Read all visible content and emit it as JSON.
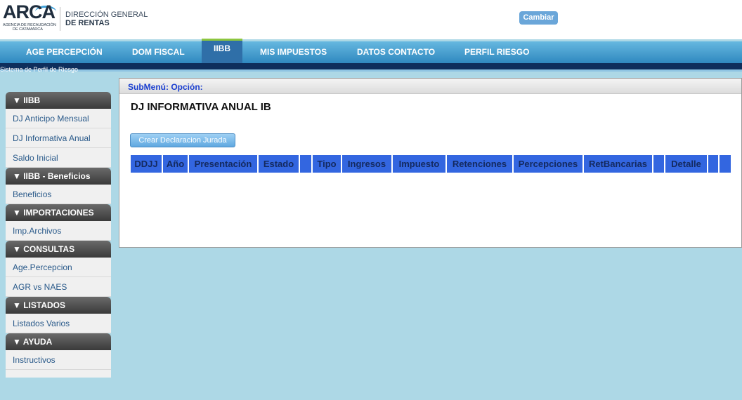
{
  "header": {
    "logo_text": "ARCA",
    "logo_sub1": "AGENCIA DE RECAUDACIÓN",
    "logo_sub2": "DE CATAMARCA",
    "agency_line1": "DIRECCIÓN GENERAL",
    "agency_line2": "DE RENTAS",
    "cambiar_label": "Cambiar"
  },
  "nav": {
    "items": [
      {
        "label": "AGE PERCEPCIÓN"
      },
      {
        "label": "DOM FISCAL"
      },
      {
        "label": "IIBB",
        "active": true
      },
      {
        "label": "MIS IMPUESTOS"
      },
      {
        "label": "DATOS CONTACTO"
      },
      {
        "label": "PERFIL RIESGO"
      }
    ],
    "system_label": "Sistema de Perfil de Riesgo"
  },
  "sidebar": {
    "sections": [
      {
        "title": "▼ IIBB",
        "items": [
          "DJ Anticipo Mensual",
          "DJ Informativa Anual",
          "Saldo Inicial"
        ]
      },
      {
        "title": "▼ IIBB - Beneficios",
        "items": [
          "Beneficios"
        ]
      },
      {
        "title": "▼ IMPORTACIONES",
        "items": [
          "Imp.Archivos"
        ]
      },
      {
        "title": "▼ CONSULTAS",
        "items": [
          "Age.Percepcion",
          "AGR vs NAES"
        ]
      },
      {
        "title": "▼ LISTADOS",
        "items": [
          "Listados Varios"
        ]
      },
      {
        "title": "▼ AYUDA",
        "items": [
          "Instructivos"
        ]
      }
    ]
  },
  "main": {
    "submenu": "SubMenú: Opción:",
    "title": "DJ INFORMATIVA ANUAL IB",
    "create_button": "Crear Declaracion Jurada",
    "columns": [
      "DDJJ",
      "Año",
      "Presentación",
      "Estado",
      "",
      "Tipo",
      "Ingresos",
      "Impuesto",
      "Retenciones",
      "Percepciones",
      "RetBancarias",
      "",
      "Detalle",
      "",
      ""
    ]
  },
  "colors": {
    "background": "#add8e6",
    "nav_gradient_top": "#66b8e0",
    "table_header": "#3366e0",
    "submenu_text": "#1a3fd0"
  }
}
